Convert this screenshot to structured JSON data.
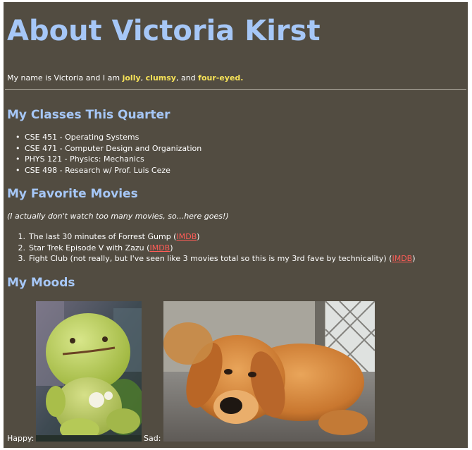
{
  "title": "About Victoria Kirst",
  "intro": {
    "prefix": "My name is Victoria and I am ",
    "traits": [
      "jolly",
      "clumsy",
      "four-eyed."
    ],
    "sep1": ", ",
    "sep2": ", and "
  },
  "classes": {
    "heading": "My Classes This Quarter",
    "items": [
      "CSE 451 - Operating Systems",
      "CSE 471 - Computer Design and Organization",
      "PHYS 121 - Physics: Mechanics",
      "CSE 498 - Research w/ Prof. Luis Ceze"
    ]
  },
  "movies": {
    "heading": "My Favorite Movies",
    "note": "(I actually don't watch too many movies, so...here goes!)",
    "link_label": "IMDB",
    "items": [
      {
        "num": "1.",
        "text": "The last 30 minutes of Forrest Gump"
      },
      {
        "num": "2.",
        "text": "Star Trek Episode V with Zazu"
      },
      {
        "num": "3.",
        "text": "Fight Club (not really, but I've seen like 3 movies total so this is my 3rd fave by technicality)"
      }
    ]
  },
  "moods": {
    "heading": "My Moods",
    "happy_label": "Happy:",
    "sad_label": "Sad:",
    "happy_image": "green-smiling-toy",
    "sad_image": "sad-puppy"
  },
  "colors": {
    "background": "#524c41",
    "heading": "#a6c7f7",
    "highlight": "#f7e358",
    "link": "#ff5c57"
  }
}
